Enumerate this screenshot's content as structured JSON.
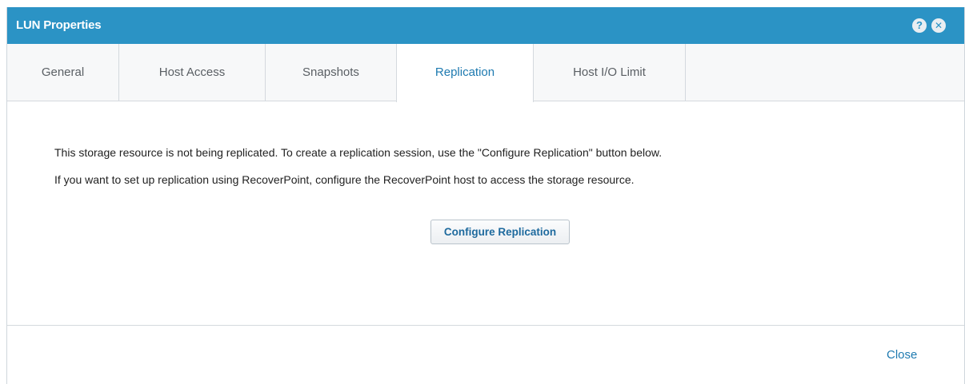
{
  "dialog": {
    "title": "LUN Properties",
    "help_icon": "help-icon",
    "close_icon": "close-icon",
    "help_glyph": "?",
    "close_glyph": "✕"
  },
  "tabs": [
    {
      "label": "General",
      "active": false
    },
    {
      "label": "Host Access",
      "active": false
    },
    {
      "label": "Snapshots",
      "active": false
    },
    {
      "label": "Replication",
      "active": true
    },
    {
      "label": "Host I/O Limit",
      "active": false
    }
  ],
  "content": {
    "line1": "This storage resource is not being replicated. To create a replication session, use the \"Configure Replication\" button below.",
    "line2": "If you want to set up replication using RecoverPoint, configure the RecoverPoint host to access the storage resource.",
    "configure_button": "Configure Replication"
  },
  "footer": {
    "close_label": "Close"
  },
  "colors": {
    "titlebar": "#2b93c5",
    "accent": "#1e7ab0"
  }
}
